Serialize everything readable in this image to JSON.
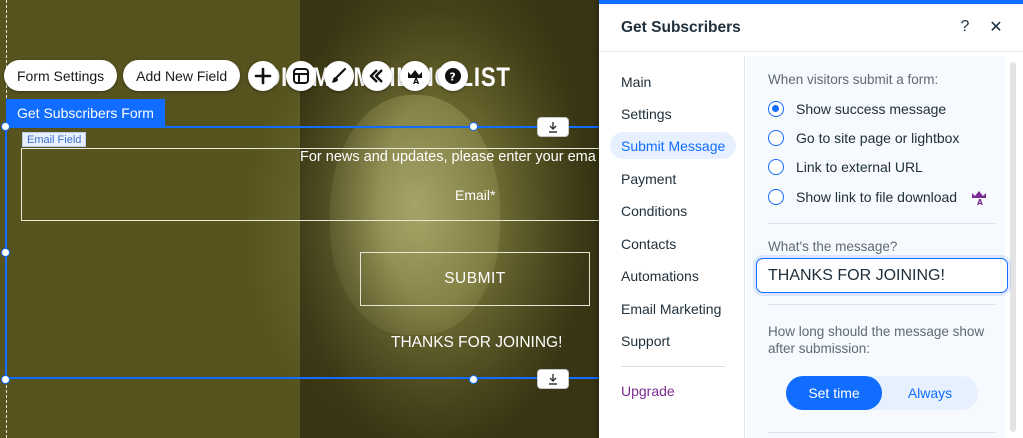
{
  "canvas": {
    "heading": "JOIN MY MAILING LIST",
    "toolbar": {
      "form_settings": "Form Settings",
      "add_new_field": "Add New Field",
      "icons": [
        "plus-icon",
        "layout-icon",
        "brush-icon",
        "animation-icon",
        "premium-icon",
        "help-icon"
      ]
    },
    "component_label": "Get Subscribers Form",
    "field_tag": "Email Field",
    "field_description": "For news and updates, please enter your ema",
    "field_label": "Email*",
    "submit_label": "SUBMIT",
    "thanks_text": "THANKS FOR JOINING!"
  },
  "panel": {
    "title": "Get Subscribers",
    "help": "?",
    "close": "✕",
    "nav": [
      {
        "label": "Main"
      },
      {
        "label": "Settings"
      },
      {
        "label": "Submit Message"
      },
      {
        "label": "Payment"
      },
      {
        "label": "Conditions"
      },
      {
        "label": "Contacts"
      },
      {
        "label": "Automations"
      },
      {
        "label": "Email Marketing"
      },
      {
        "label": "Support"
      },
      {
        "label": "Upgrade"
      }
    ],
    "active_nav": "Submit Message",
    "submit_prompt": "When visitors submit a form:",
    "options": [
      {
        "label": "Show success message",
        "selected": true
      },
      {
        "label": "Go to site page or lightbox",
        "selected": false
      },
      {
        "label": "Link to external URL",
        "selected": false
      },
      {
        "label": "Show link to file download",
        "selected": false,
        "premium": true
      }
    ],
    "message_label": "What's the message?",
    "message_value": "THANKS FOR JOINING!",
    "duration_label_line1": "How long should the message show",
    "duration_label_line2": "after submission:",
    "duration_options": [
      {
        "label": "Set time",
        "selected": true
      },
      {
        "label": "Always",
        "selected": false
      }
    ]
  },
  "colors": {
    "accent": "#116dff",
    "premium": "#7b2b92"
  }
}
